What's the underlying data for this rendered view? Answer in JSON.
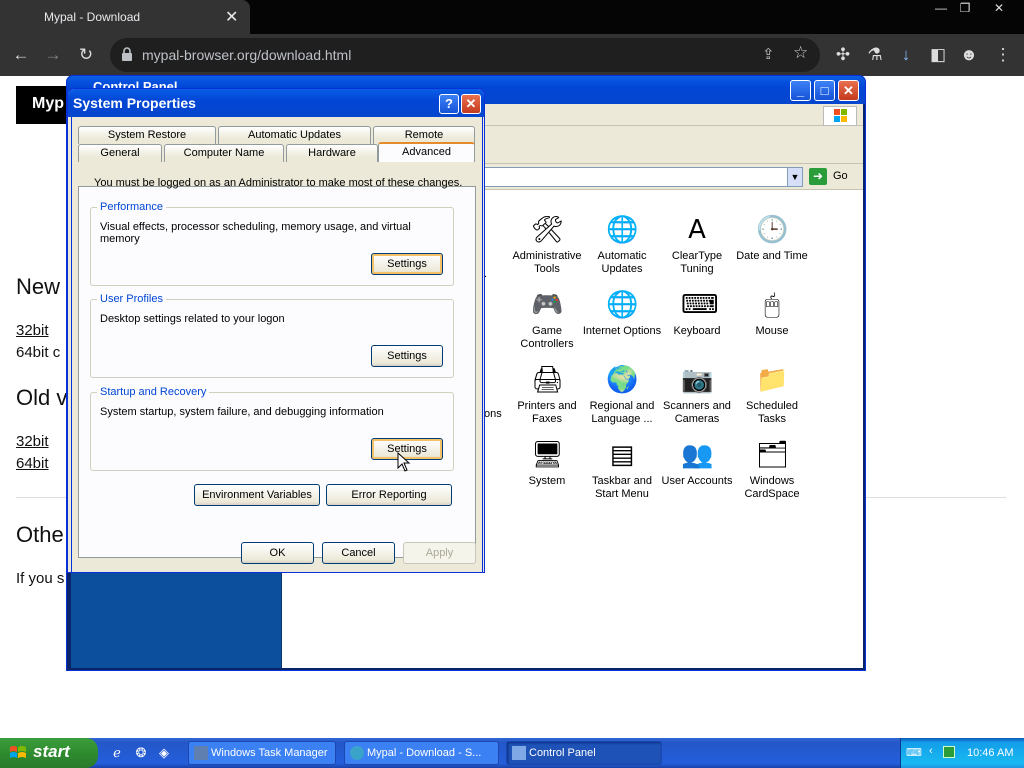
{
  "browser": {
    "tab_title": "Mypal - Download",
    "url": "mypal-browser.org/download.html"
  },
  "page": {
    "logo_text": "Myp",
    "heading_new": "New",
    "link_32bit_new": "32bit",
    "text_64bit_new": "64bit c",
    "heading_old": "Old v",
    "link_32bit_old": "32bit",
    "link_64bit_old": "64bit",
    "heading_other": "Othe",
    "text_if_you": "If you s"
  },
  "control_panel": {
    "title": "Control Panel",
    "go_label": "Go",
    "partial_label_1": ".",
    "partial_label_2": "ons",
    "icons": [
      {
        "label": "Administrative Tools",
        "icon": "administrative-tools-icon"
      },
      {
        "label": "Automatic Updates",
        "icon": "automatic-updates-icon"
      },
      {
        "label": "ClearType Tuning",
        "icon": "cleartype-icon"
      },
      {
        "label": "Date and Time",
        "icon": "date-time-icon"
      },
      {
        "label": "Game Controllers",
        "icon": "game-controllers-icon"
      },
      {
        "label": "Internet Options",
        "icon": "internet-options-icon"
      },
      {
        "label": "Keyboard",
        "icon": "keyboard-icon"
      },
      {
        "label": "Mouse",
        "icon": "mouse-icon"
      },
      {
        "label": "Printers and Faxes",
        "icon": "printers-icon"
      },
      {
        "label": "Regional and Language ...",
        "icon": "regional-icon"
      },
      {
        "label": "Scanners and Cameras",
        "icon": "scanners-icon"
      },
      {
        "label": "Scheduled Tasks",
        "icon": "scheduled-tasks-icon"
      },
      {
        "label": "System",
        "icon": "system-icon"
      },
      {
        "label": "Taskbar and Start Menu",
        "icon": "taskbar-icon"
      },
      {
        "label": "User Accounts",
        "icon": "user-accounts-icon"
      },
      {
        "label": "Windows CardSpace",
        "icon": "cardspace-icon"
      }
    ]
  },
  "system_properties": {
    "title": "System Properties",
    "tabs_row1": [
      "System Restore",
      "Automatic Updates",
      "Remote"
    ],
    "tabs_row2": [
      "General",
      "Computer Name",
      "Hardware",
      "Advanced"
    ],
    "active_tab": "Advanced",
    "admin_notice": "You must be logged on as an Administrator to make most of these changes.",
    "performance": {
      "label": "Performance",
      "description": "Visual effects, processor scheduling, memory usage, and virtual memory",
      "button": "Settings"
    },
    "user_profiles": {
      "label": "User Profiles",
      "description": "Desktop settings related to your logon",
      "button": "Settings"
    },
    "startup_recovery": {
      "label": "Startup and Recovery",
      "description": "System startup, system failure, and debugging information",
      "button": "Settings"
    },
    "env_vars_button": "Environment Variables",
    "error_reporting_button": "Error Reporting",
    "ok_button": "OK",
    "cancel_button": "Cancel",
    "apply_button": "Apply"
  },
  "taskbar": {
    "start_label": "start",
    "tasks": [
      "Windows Task Manager",
      "Mypal - Download - S...",
      "Control Panel"
    ],
    "active_task": "Control Panel",
    "clock": "10:46 AM"
  },
  "colors": {
    "xp_blue": "#0446cd",
    "side_panel": "#0c4f9c",
    "taskbar": "#245edb",
    "start_green": "#3c9e3c"
  }
}
